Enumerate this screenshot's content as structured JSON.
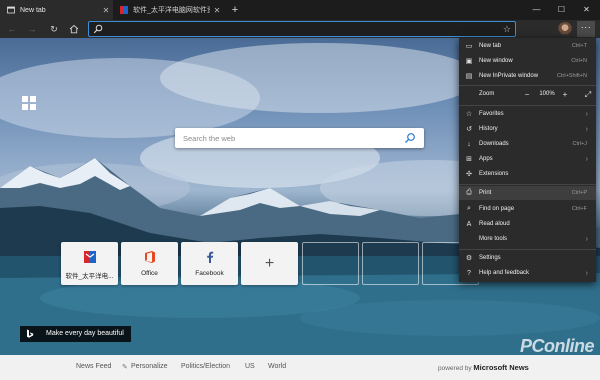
{
  "tabs": [
    {
      "label": "New tab",
      "active": true
    },
    {
      "label": "软件_太平洋电脑网软件资讯频道",
      "active": false
    }
  ],
  "toolbar": {
    "address_value": "",
    "icons": [
      "back-icon",
      "forward-icon",
      "refresh-icon",
      "home-icon",
      "search-icon",
      "favorite-star-icon",
      "settings-more-icon"
    ]
  },
  "search": {
    "placeholder": "Search the web"
  },
  "quick_links": [
    {
      "label": "软件_太平洋电...",
      "icon": "pconline-icon"
    },
    {
      "label": "Office",
      "icon": "office-icon"
    },
    {
      "label": "Facebook",
      "icon": "facebook-icon"
    }
  ],
  "add_tile_symbol": "+",
  "caption": "Make every day beautiful",
  "news": {
    "items": [
      "News Feed",
      "Personalize",
      "Politics/Election",
      "US",
      "World"
    ],
    "powered_prefix": "powered by",
    "powered_brand": "Microsoft News"
  },
  "watermark": "PConline",
  "menu": {
    "items": [
      {
        "label": "New tab",
        "shortcut": "Ctrl+T",
        "icon": "new-tab-icon"
      },
      {
        "label": "New window",
        "shortcut": "Ctrl+N",
        "icon": "new-window-icon"
      },
      {
        "label": "New InPrivate window",
        "shortcut": "Ctrl+Shift+N",
        "icon": "inprivate-icon"
      },
      {
        "label": "Favorites",
        "icon": "favorites-icon"
      },
      {
        "label": "History",
        "icon": "history-icon"
      },
      {
        "label": "Downloads",
        "shortcut": "Ctrl+J",
        "icon": "downloads-icon"
      },
      {
        "label": "Apps",
        "icon": "apps-icon"
      },
      {
        "label": "Extensions",
        "icon": "extensions-icon"
      },
      {
        "label": "Print",
        "shortcut": "Ctrl+P",
        "icon": "print-icon"
      },
      {
        "label": "Find on page",
        "shortcut": "Ctrl+F",
        "icon": "find-icon"
      },
      {
        "label": "Read aloud",
        "icon": "read-aloud-icon"
      },
      {
        "label": "More tools",
        "icon": ""
      },
      {
        "label": "Settings",
        "icon": "settings-icon"
      },
      {
        "label": "Help and feedback",
        "icon": "help-icon"
      }
    ],
    "zoom_label": "Zoom",
    "zoom_value": "100%",
    "zoom_minus": "−",
    "zoom_plus": "+"
  },
  "colors": {
    "accent": "#3b8fd9",
    "menu_bg": "#2b2b2b",
    "tab_bg": "#1c1c1c"
  }
}
